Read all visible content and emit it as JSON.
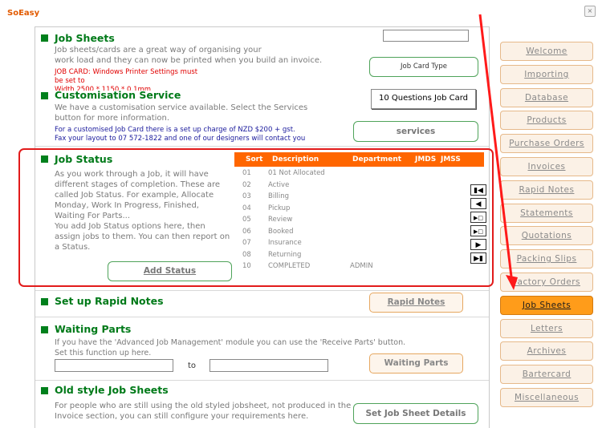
{
  "app": {
    "title": "SoEasy",
    "close_icon": "×"
  },
  "job_sheets": {
    "title": "Job Sheets",
    "desc_1": "Job sheets/cards are a great way of organising your",
    "desc_2": "work load and they can now be printed when you build an invoice.",
    "warn_1": "JOB CARD: Windows Printer Settings must",
    "warn_2": "be set to",
    "warn_3": "Width 2500 * 1150 * 0.1mm",
    "input_value": "",
    "button": "Job Card Type"
  },
  "customisation": {
    "title": "Customisation Service",
    "desc_1": "We have a customisation service available. Select the Services",
    "desc_2": "button for more information.",
    "info_1": "For a customised Job Card there is a set up charge of NZD $200 + gst.",
    "info_2": "Fax your layout to 07 572-1822 and one of our designers will contact you",
    "questions_button": "10 Questions Job Card",
    "services_button": "services"
  },
  "job_status": {
    "title": "Job Status",
    "desc": [
      "As you work through a Job, it will have",
      "different stages of completion. These are",
      "called Job Status. For example,  Allocate",
      "Monday, Work In Progress, Finished,",
      "Waiting For Parts...",
      "You add Job Status options here, then",
      "assign jobs to them. You can then report on",
      "a Status."
    ],
    "add_button": "Add Status",
    "columns": {
      "sort": "Sort",
      "description": "Description",
      "department": "Department",
      "jmds": "JMDS",
      "jmss": "JMSS"
    },
    "rows": [
      {
        "sort": "01",
        "description": "01 Not Allocated",
        "department": ""
      },
      {
        "sort": "02",
        "description": "Active",
        "department": ""
      },
      {
        "sort": "03",
        "description": "Billing",
        "department": ""
      },
      {
        "sort": "04",
        "description": "Pickup",
        "department": ""
      },
      {
        "sort": "05",
        "description": "Review",
        "department": ""
      },
      {
        "sort": "06",
        "description": "Booked",
        "department": ""
      },
      {
        "sort": "07",
        "description": "Insurance",
        "department": ""
      },
      {
        "sort": "08",
        "description": "Returning",
        "department": ""
      },
      {
        "sort": "10",
        "description": "COMPLETED",
        "department": "ADMIN"
      }
    ],
    "nav": {
      "first": "⏮",
      "prev": "◀",
      "insert": "▶",
      "append": "▶",
      "next": "▶",
      "last": "⏭"
    }
  },
  "rapid_notes": {
    "title": "Set up Rapid Notes",
    "button": "Rapid Notes"
  },
  "waiting_parts": {
    "title": "Waiting Parts",
    "desc_1": "If you have the 'Advanced Job Management' module you can use the 'Receive Parts' button.",
    "desc_2": "Set this function up here.",
    "from_value": "",
    "to_label": "to",
    "to_value": "",
    "button": "Waiting Parts"
  },
  "old_style": {
    "title": "Old style Job Sheets",
    "desc_1": "For people who are still using the old styled jobsheet, not produced in the",
    "desc_2": "Invoice section, you can still configure your requirements here.",
    "button": "Set Job Sheet Details"
  },
  "sidebar": {
    "items": [
      {
        "label": "Welcome"
      },
      {
        "label": "Importing"
      },
      {
        "label": "Database"
      },
      {
        "label": "Products"
      },
      {
        "label": "Purchase Orders"
      },
      {
        "label": "Invoices"
      },
      {
        "label": "Rapid Notes"
      },
      {
        "label": "Statements"
      },
      {
        "label": "Quotations"
      },
      {
        "label": "Packing Slips"
      },
      {
        "label": "Factory Orders"
      },
      {
        "label": "Job Sheets"
      },
      {
        "label": "Letters"
      },
      {
        "label": "Archives"
      },
      {
        "label": "Bartercard"
      },
      {
        "label": "Miscellaneous"
      }
    ],
    "active": "Job Sheets"
  },
  "colors": {
    "accent": "#ff6600",
    "heading": "#007a19",
    "highlight": "#e21b1b",
    "active_tab": "#ff9c1a"
  }
}
